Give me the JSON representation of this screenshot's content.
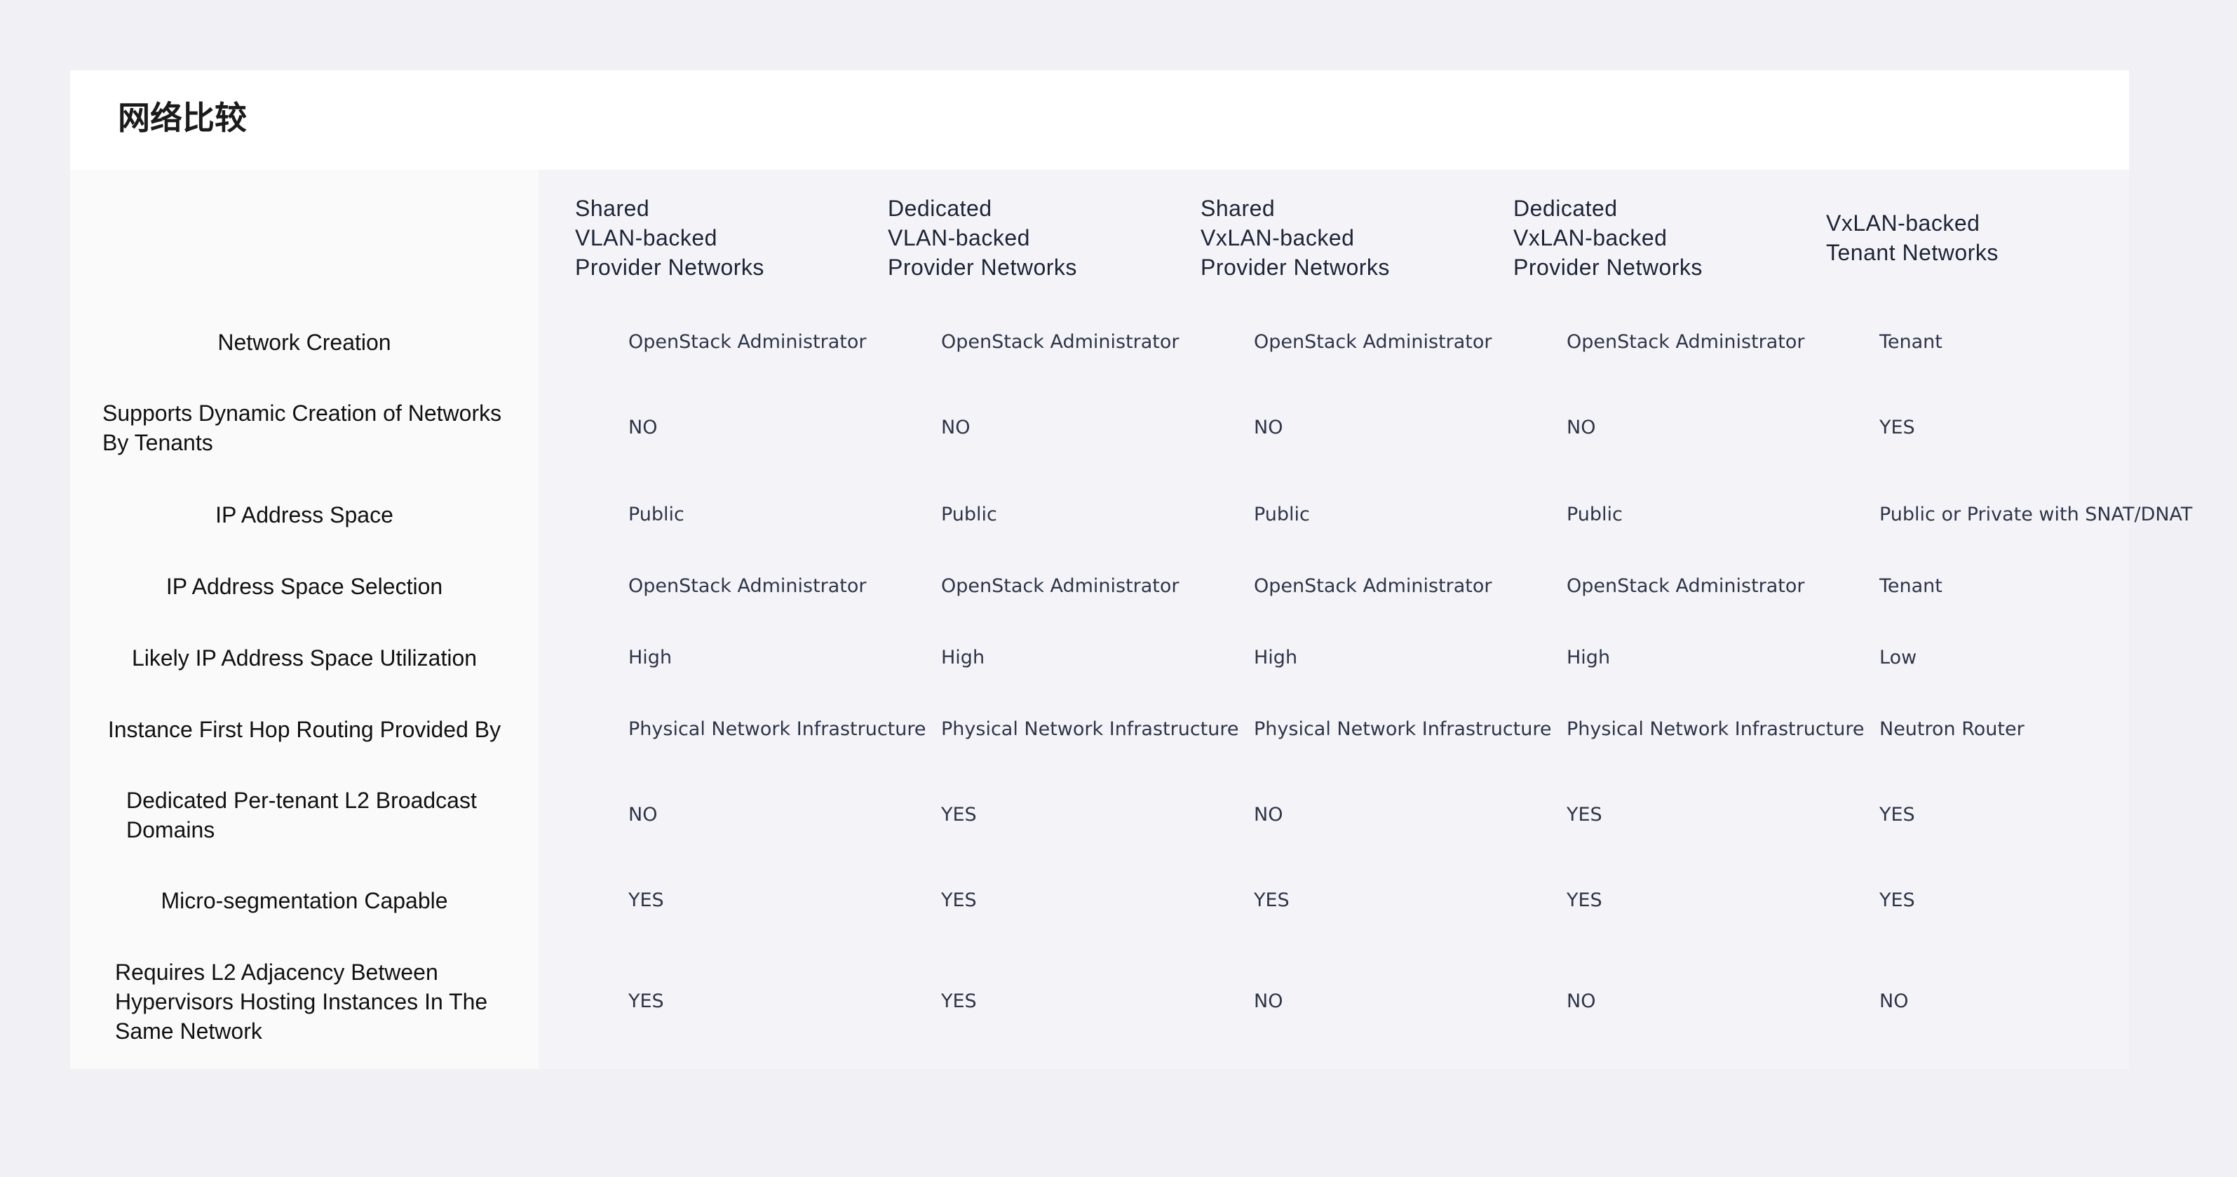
{
  "title": "网络比较",
  "columns": [
    {
      "lines": [
        "Shared",
        "VLAN-backed",
        "Provider Networks"
      ]
    },
    {
      "lines": [
        "Dedicated",
        "VLAN-backed",
        "Provider Networks"
      ]
    },
    {
      "lines": [
        "Shared",
        "VxLAN-backed",
        "Provider Networks"
      ]
    },
    {
      "lines": [
        "Dedicated",
        "VxLAN-backed",
        "Provider Networks"
      ]
    },
    {
      "lines": [
        "VxLAN-backed",
        "Tenant Networks"
      ]
    }
  ],
  "rows": [
    {
      "lines": [
        "Network Creation"
      ],
      "values": [
        "OpenStack Administrator",
        "OpenStack Administrator",
        "OpenStack Administrator",
        "OpenStack Administrator",
        "Tenant"
      ]
    },
    {
      "lines": [
        "Supports Dynamic Creation of Networks",
        "By Tenants"
      ],
      "values": [
        "NO",
        "NO",
        "NO",
        "NO",
        "YES"
      ]
    },
    {
      "lines": [
        "IP Address Space"
      ],
      "values": [
        "Public",
        "Public",
        "Public",
        "Public",
        "Public or Private with SNAT/DNAT"
      ]
    },
    {
      "lines": [
        "IP Address Space Selection"
      ],
      "values": [
        "OpenStack Administrator",
        "OpenStack Administrator",
        "OpenStack Administrator",
        "OpenStack Administrator",
        "Tenant"
      ]
    },
    {
      "lines": [
        "Likely IP Address Space Utilization"
      ],
      "values": [
        "High",
        "High",
        "High",
        "High",
        "Low"
      ]
    },
    {
      "lines": [
        "Instance First Hop Routing Provided By"
      ],
      "values": [
        "Physical Network Infrastructure",
        "Physical Network Infrastructure",
        "Physical Network Infrastructure",
        "Physical Network Infrastructure",
        "Neutron Router"
      ]
    },
    {
      "lines": [
        "Dedicated Per-tenant L2 Broadcast",
        "Domains"
      ],
      "values": [
        "NO",
        "YES",
        "NO",
        "YES",
        "YES"
      ]
    },
    {
      "lines": [
        "Micro-segmentation Capable"
      ],
      "values": [
        "YES",
        "YES",
        "YES",
        "YES",
        "YES"
      ]
    },
    {
      "lines": [
        "Requires L2 Adjacency Between",
        "Hypervisors Hosting Instances In The",
        "Same Network"
      ],
      "values": [
        "YES",
        "YES",
        "NO",
        "NO",
        "NO"
      ]
    }
  ]
}
